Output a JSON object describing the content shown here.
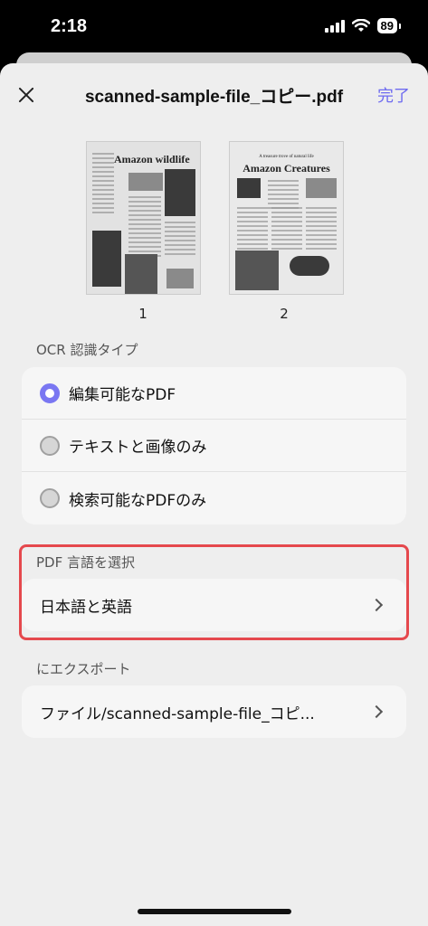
{
  "status": {
    "time": "2:18",
    "battery": "89"
  },
  "header": {
    "title": "scanned-sample-file_コピー.pdf",
    "done_label": "完了"
  },
  "thumbnails": [
    {
      "page": "1",
      "heading": "Amazon wildlife"
    },
    {
      "page": "2",
      "subheading": "A treasure trove of natural life",
      "heading": "Amazon Creatures"
    }
  ],
  "ocr": {
    "section_label": "OCR 認識タイプ",
    "options": [
      {
        "label": "編集可能なPDF",
        "selected": true
      },
      {
        "label": "テキストと画像のみ",
        "selected": false
      },
      {
        "label": "検索可能なPDFのみ",
        "selected": false
      }
    ]
  },
  "language": {
    "section_label": "PDF 言語を選択",
    "value": "日本語と英語"
  },
  "export": {
    "section_label": "にエクスポート",
    "value": "ファイル/scanned-sample-file_コピ..."
  },
  "colors": {
    "accent": "#7a77f2",
    "done": "#6e6bf0",
    "highlight": "#e5484d"
  }
}
